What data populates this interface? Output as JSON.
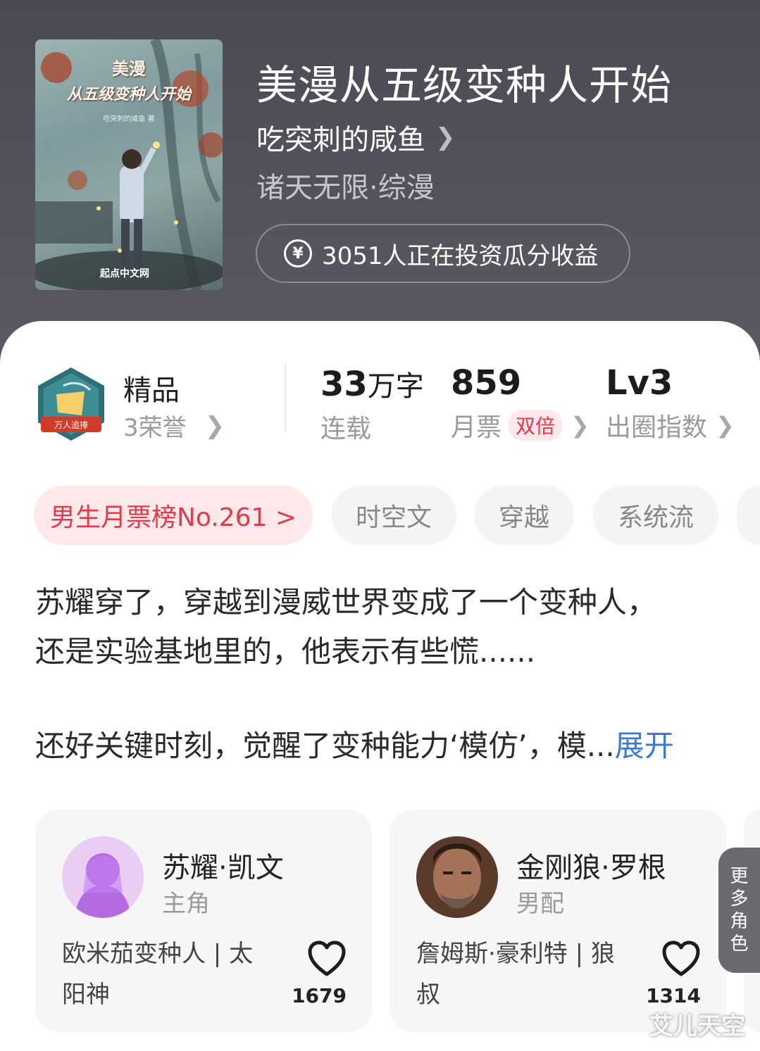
{
  "book": {
    "cover": {
      "title_line1": "美漫",
      "title_line2": "从五级变种人开始",
      "author_small": "吃突刺的咸鱼 著",
      "publisher": "起点中文网"
    },
    "title": "美漫从五级变种人开始",
    "author": "吃突刺的咸鱼",
    "genre": "诸天无限·综漫",
    "invest_text": "3051人正在投资瓜分收益"
  },
  "honor": {
    "badge_text": "万人追捧",
    "title": "精品",
    "subtitle": "3荣誉"
  },
  "stats": {
    "words_num": "33",
    "words_unit": "万字",
    "words_label": "连载",
    "tickets_num": "859",
    "tickets_label": "月票",
    "tickets_tag": "双倍",
    "level_num": "Lv3",
    "level_label": "出圈指数"
  },
  "tags": {
    "rank": "男生月票榜No.261 >",
    "t1": "时空文",
    "t2": "穿越",
    "t3": "系统流"
  },
  "synopsis": {
    "line1": "苏耀穿了，穿越到漫威世界变成了一个变种人，",
    "line2": "还是实验基地里的，他表示有些慌......",
    "line3": "还好关键时刻，觉醒了变种能力‘模仿’，模...",
    "expand": "展开"
  },
  "roles": [
    {
      "name": "苏耀·凯文",
      "type": "主角",
      "desc": "欧米茄变种人 | 太阳神",
      "likes": "1679"
    },
    {
      "name": "金刚狼·罗根",
      "type": "男配",
      "desc": "詹姆斯·豪利特 | 狼叔",
      "likes": "1314"
    }
  ],
  "more_roles": "更多角色",
  "watermark": "艾儿天空",
  "colors": {
    "header_bg": "#4f4e58",
    "rank_chip_bg": "#fde8ea",
    "rank_chip_text": "#e23a4a",
    "expand_link": "#3a7ad6",
    "double_tag": "#e8344f"
  }
}
